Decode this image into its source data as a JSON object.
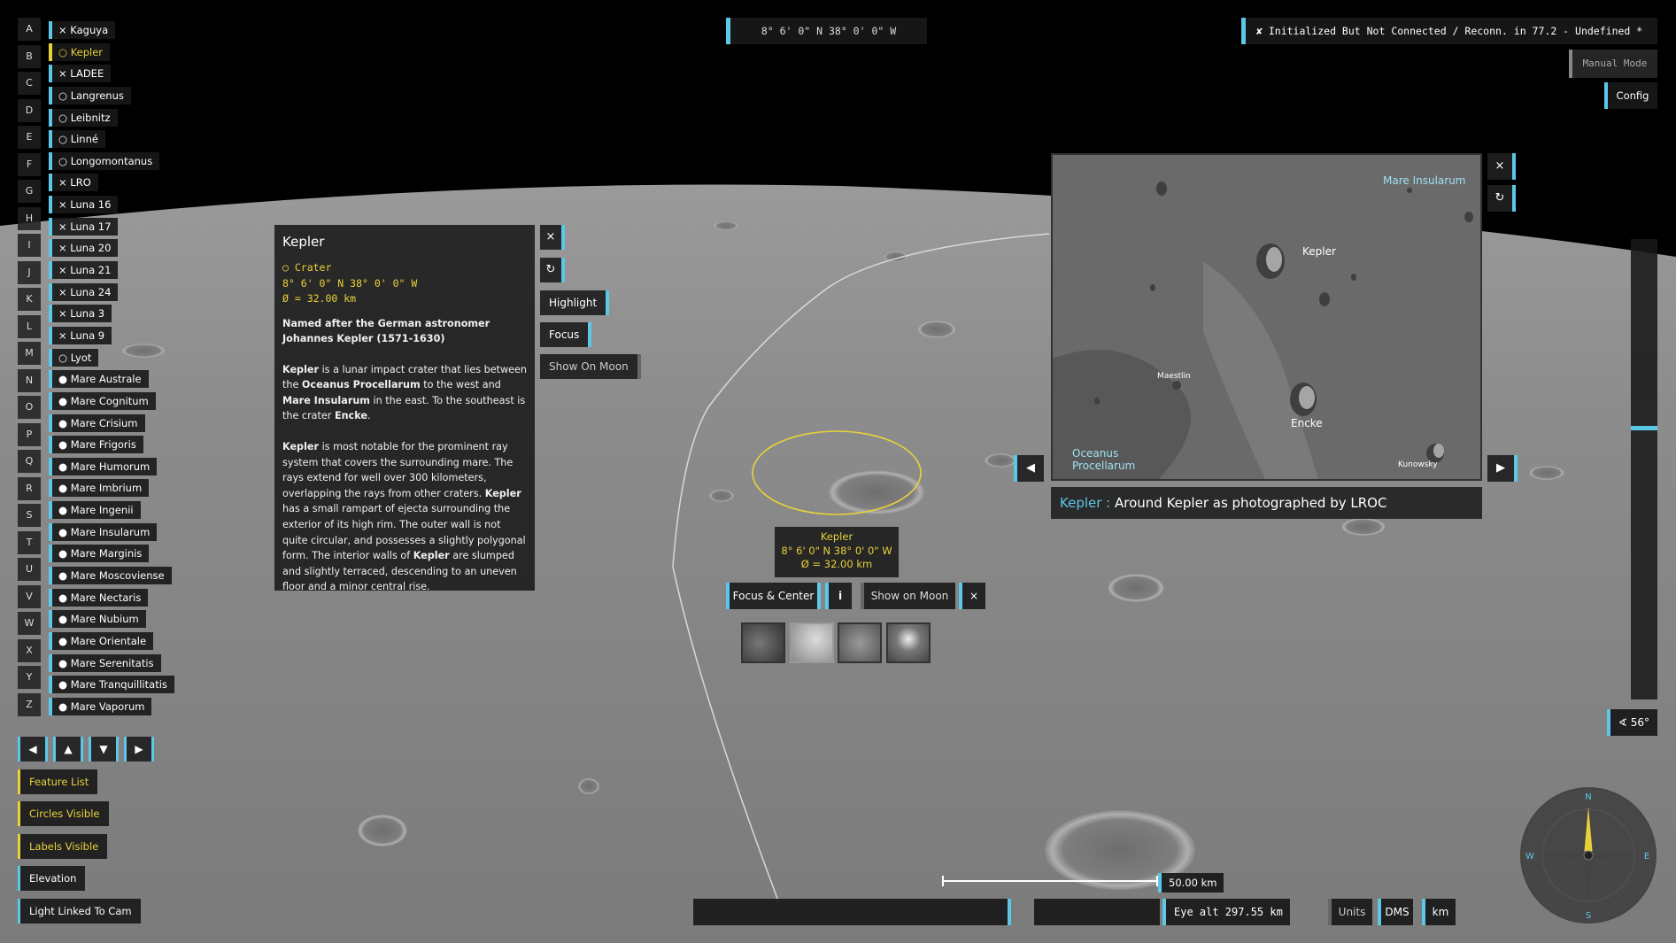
{
  "letters": [
    "A",
    "B",
    "C",
    "D",
    "E",
    "F",
    "G",
    "H",
    "I",
    "J",
    "K",
    "L",
    "M",
    "N",
    "O",
    "P",
    "Q",
    "R",
    "S",
    "T",
    "U",
    "V",
    "W",
    "X",
    "Y",
    "Z"
  ],
  "features": [
    {
      "label": "× Kaguya",
      "selected": false
    },
    {
      "label": "○ Kepler",
      "selected": true
    },
    {
      "label": "× LADEE",
      "selected": false
    },
    {
      "label": "○ Langrenus",
      "selected": false
    },
    {
      "label": "○ Leibnitz",
      "selected": false
    },
    {
      "label": "○ Linné",
      "selected": false
    },
    {
      "label": "○ Longomontanus",
      "selected": false
    },
    {
      "label": "× LRO",
      "selected": false
    },
    {
      "label": "× Luna 16",
      "selected": false
    },
    {
      "label": "× Luna 17",
      "selected": false
    },
    {
      "label": "× Luna 20",
      "selected": false
    },
    {
      "label": "× Luna 21",
      "selected": false
    },
    {
      "label": "× Luna 24",
      "selected": false
    },
    {
      "label": "× Luna 3",
      "selected": false
    },
    {
      "label": "× Luna 9",
      "selected": false
    },
    {
      "label": "○ Lyot",
      "selected": false
    },
    {
      "label": "● Mare Australe",
      "selected": false
    },
    {
      "label": "● Mare Cognitum",
      "selected": false
    },
    {
      "label": "● Mare Crisium",
      "selected": false
    },
    {
      "label": "● Mare Frigoris",
      "selected": false
    },
    {
      "label": "● Mare Humorum",
      "selected": false
    },
    {
      "label": "● Mare Imbrium",
      "selected": false
    },
    {
      "label": "● Mare Ingenii",
      "selected": false
    },
    {
      "label": "● Mare Insularum",
      "selected": false
    },
    {
      "label": "● Mare Marginis",
      "selected": false
    },
    {
      "label": "● Mare Moscoviense",
      "selected": false
    },
    {
      "label": "● Mare Nectaris",
      "selected": false
    },
    {
      "label": "● Mare Nubium",
      "selected": false
    },
    {
      "label": "● Mare Orientale",
      "selected": false
    },
    {
      "label": "● Mare Serenitatis",
      "selected": false
    },
    {
      "label": "● Mare Tranquillitatis",
      "selected": false
    },
    {
      "label": "● Mare Vaporum",
      "selected": false
    }
  ],
  "arrows": [
    "◀",
    "▲",
    "▼",
    "▶"
  ],
  "toggles": {
    "feature_list": "Feature List",
    "circles_visible": "Circles Visible",
    "labels_visible": "Labels Visible",
    "elevation": "Elevation",
    "light_linked": "Light Linked To Cam"
  },
  "top_coord": "8°  6'  0\" N  38°  0'  0\" W",
  "status": "✘ Initialized But Not Connected / Reconn. in 77.2 - Undefined *",
  "manual_mode": "Manual Mode",
  "config": "Config",
  "info": {
    "title": "Kepler",
    "type": "○ Crater",
    "coords": "8°  6'  0\" N  38°  0'  0\" W",
    "diameter": "Ø = 32.00 km",
    "p1_bold": "Named after the German astronomer Johannes Kepler (1571-1630)",
    "p2_a": "Kepler",
    "p2_b": " is a lunar impact crater that lies between the ",
    "p2_c": "Oceanus Procellarum",
    "p2_d": " to the west and ",
    "p2_e": "Mare Insularum",
    "p2_f": " in the east. To the southeast is the crater ",
    "p2_g": "Encke",
    "p2_h": ".",
    "p3_a": "Kepler",
    "p3_b": " is most notable for the prominent ray system that covers the surrounding mare. The rays extend for well over 300 kilometers, overlapping the rays from other craters. ",
    "p3_c": "Kepler",
    "p3_d": " has a small rampart of ejecta surrounding the exterior of its high rim. The outer wall is not quite circular, and possesses a slightly polygonal form. The interior walls of ",
    "p3_e": "Kepler",
    "p3_f": " are slumped and slightly terraced, descending to an uneven floor and a minor central rise.",
    "close": "×",
    "refresh": "↻",
    "highlight": "Highlight",
    "focus": "Focus",
    "show_on_moon": "Show On Moon"
  },
  "photo": {
    "label_mare_insularum": "Mare Insularum",
    "label_kepler": "Kepler",
    "label_maestlin": "Maestlin",
    "label_encke": "Encke",
    "label_oceanus": "Oceanus Procellarum",
    "label_kunowsky": "Kunowsky",
    "caption_name": "Kepler :",
    "caption_text": " Around Kepler as photographed by LROC",
    "close": "×",
    "refresh": "↻",
    "prev": "◀",
    "next": "▶"
  },
  "center_label": {
    "name": "Kepler",
    "coords": "8° 6' 0\" N 38° 0' 0\" W",
    "diameter": "Ø = 32.00 km",
    "focus_center": "Focus & Center",
    "info": "i",
    "show_on_moon": "Show on Moon",
    "close": "×"
  },
  "angle": "∢ 56°",
  "scale": "50.00 km",
  "eye_alt": "Eye alt 297.55 km",
  "units": "Units",
  "dms": "DMS",
  "km": "km",
  "compass": {
    "n": "N",
    "s": "S",
    "e": "E",
    "w": "W"
  },
  "colors": {
    "accent": "#5cc8e8",
    "selected": "#e8d23a"
  }
}
